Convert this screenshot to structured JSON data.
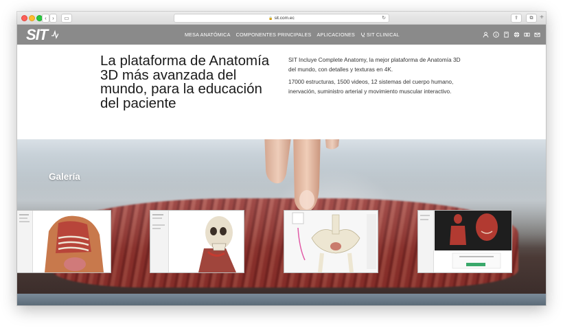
{
  "browser": {
    "url": "sit.com.ec",
    "buttons": {
      "back": "‹",
      "forward": "›",
      "sidebar": "▭",
      "share": "⇪",
      "tabs": "⧉",
      "new_tab": "+"
    }
  },
  "site_nav": {
    "logo_text": "SIT",
    "menu": [
      {
        "label": "MESA ANATÓMICA"
      },
      {
        "label": "COMPONENTES PRINCIPALES"
      },
      {
        "label": "APLICACIONES"
      },
      {
        "label": "SIT CLINICAL",
        "icon": "stethoscope-icon"
      }
    ],
    "icons": [
      "user-icon",
      "info-icon",
      "book-icon",
      "globe-icon",
      "cards-icon",
      "mail-icon"
    ]
  },
  "hero": {
    "headline": "La plataforma de Anatomía 3D más avanzada del mundo, para la educación del paciente",
    "description_1": "SIT Incluye Complete Anatomy, la mejor plataforma de Anatomía 3D del mundo, con detalles y texturas en 4K.",
    "description_2": "17000 estructuras, 1500 videos, 12 sistemas del cuerpo humano, inervación, suministro arterial y movimiento muscular interactivo."
  },
  "gallery": {
    "title": "Galería",
    "items": [
      {
        "icon": "torso-anatomy-thumbnail"
      },
      {
        "icon": "skull-neck-thumbnail"
      },
      {
        "icon": "pelvis-thumbnail"
      },
      {
        "icon": "muscular-figures-thumbnail"
      }
    ]
  },
  "colors": {
    "nav_bg": "#8a8a8a",
    "text_dark": "#1a1a1a",
    "muscle_red": "#9b2e28"
  }
}
